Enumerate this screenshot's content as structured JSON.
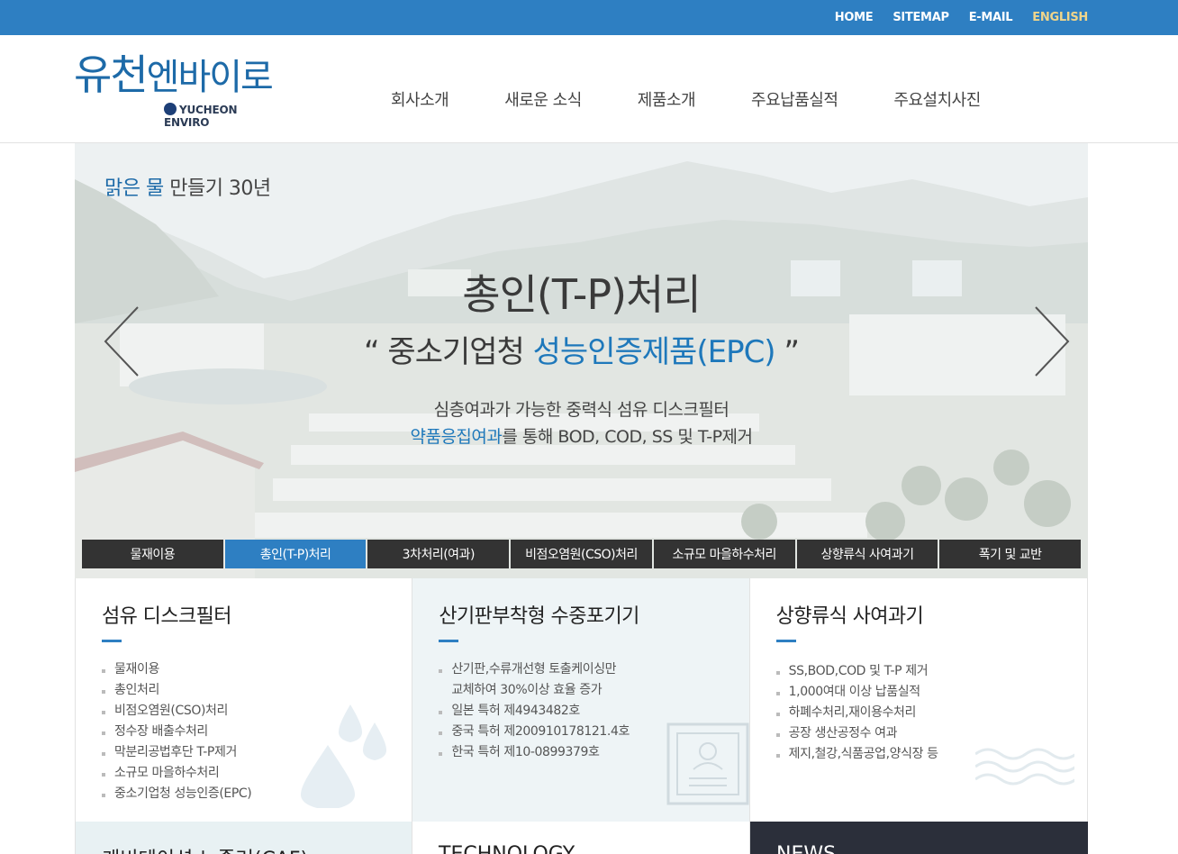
{
  "topbar": {
    "links": [
      "HOME",
      "SITEMAP",
      "E-MAIL",
      "ENGLISH"
    ]
  },
  "header": {
    "logo_ko_1": "유천",
    "logo_ko_2": "엔바이로",
    "logo_en": "YUCHEON ENVIRO",
    "nav": [
      "회사소개",
      "새로운 소식",
      "제품소개",
      "주요납품실적",
      "주요설치사진"
    ]
  },
  "hero": {
    "tag_blue": "맑은 물",
    "tag_rest": " 만들기 30년",
    "title": "총인(T-P)처리",
    "subtitle_open": "“ 중소기업청 ",
    "subtitle_blue": "성능인증제품(EPC)",
    "subtitle_close": " ”",
    "desc1": "심층여과가 가능한 중력식 섬유 디스크필터",
    "desc2_blue": "약품응집여과",
    "desc2_rest": "를 통해 BOD, COD, SS 및 T-P제거",
    "tabs": [
      "물재이용",
      "총인(T-P)처리",
      "3차처리(여과)",
      "비점오염원(CSO)처리",
      "소규모 마을하수처리",
      "상향류식 사여과기",
      "폭기 및 교반"
    ],
    "active_tab": 1
  },
  "panels": [
    {
      "title": "섬유 디스크필터",
      "items": [
        "물재이용",
        "총인처리",
        "비점오염원(CSO)처리",
        "정수장 배출수처리",
        "막분리공법후단 T-P제거",
        "소규모 마을하수처리",
        "중소기업청 성능인증(EPC)"
      ]
    },
    {
      "title": "산기판부착형 수중포기기",
      "items": [
        "산기판,수류개선형 토출케이싱만",
        "일본 특허 제4943482호",
        "중국 특허 제200910178121.4호",
        "한국 특허 제10-0899379호"
      ],
      "item0_cont": "교체하여 30%이상 효율 증가"
    },
    {
      "title": "상향류식 사여과기",
      "items": [
        "SS,BOD,COD 및 T-P 제거",
        "1,000여대 이상 납품실적",
        "하폐수처리,재이용수처리",
        "공장 생산공정수 여과",
        "제지,철강,식품공업,양식장 등"
      ]
    }
  ],
  "bottom": [
    "케비테이션 노즐러(CAF)",
    "TECHNOLOGY",
    "NEWS"
  ],
  "colors": {
    "topbar": "#2e7fc2",
    "brand_blue": "#1d6aa8",
    "accent": "#1e78bb",
    "tab_dark": "#333333",
    "english_link": "#f0d58a"
  }
}
